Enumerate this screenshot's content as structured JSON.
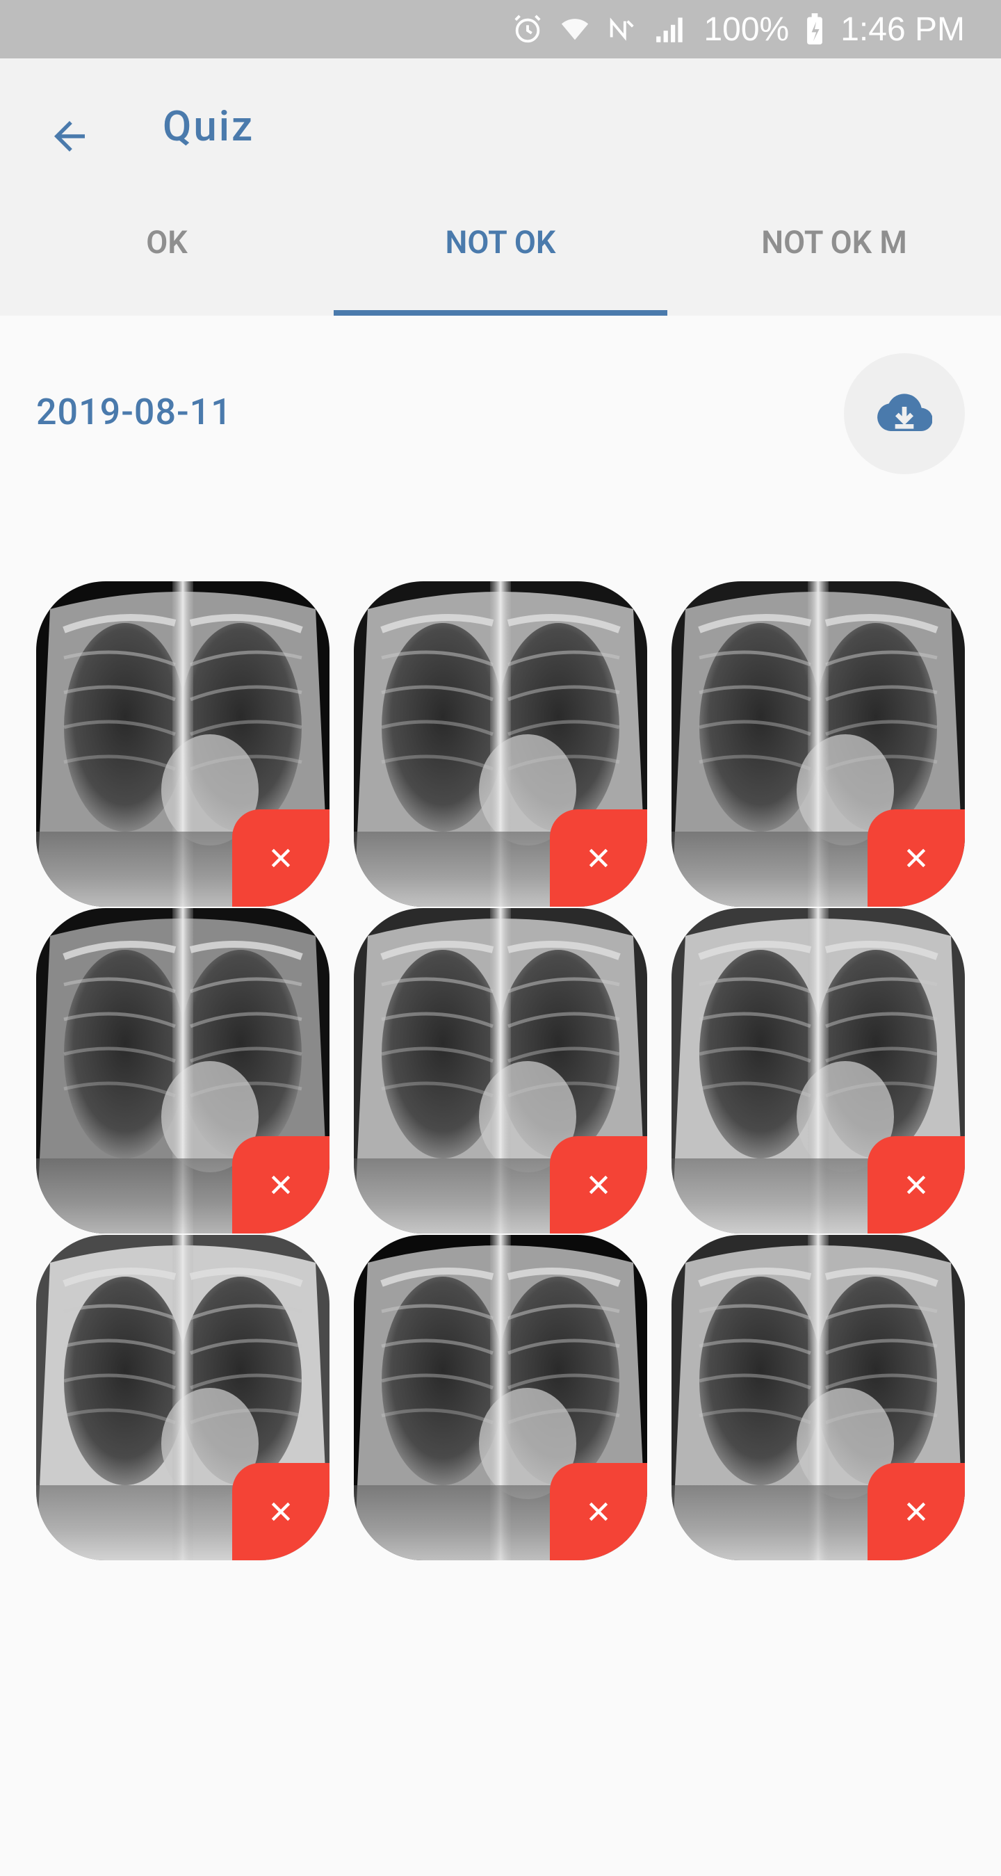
{
  "status_bar": {
    "battery": "100%",
    "time": "1:46 PM"
  },
  "app_bar": {
    "title": "Quiz",
    "back_icon": "arrow-left-icon"
  },
  "tabs": [
    {
      "label": "OK",
      "active": false
    },
    {
      "label": "NOT OK",
      "active": true
    },
    {
      "label": "NOT OK M",
      "active": false
    }
  ],
  "content": {
    "date": "2019-08-11",
    "download_icon": "cloud-download-icon"
  },
  "images": [
    {
      "kind": "chest-xray",
      "remove_icon": "close-icon"
    },
    {
      "kind": "chest-xray",
      "remove_icon": "close-icon"
    },
    {
      "kind": "chest-xray",
      "remove_icon": "close-icon"
    },
    {
      "kind": "chest-xray",
      "remove_icon": "close-icon"
    },
    {
      "kind": "chest-xray",
      "remove_icon": "close-icon"
    },
    {
      "kind": "chest-xray",
      "remove_icon": "close-icon"
    },
    {
      "kind": "chest-xray",
      "remove_icon": "close-icon"
    },
    {
      "kind": "chest-xray",
      "remove_icon": "close-icon"
    },
    {
      "kind": "chest-xray",
      "remove_icon": "close-icon"
    }
  ],
  "colors": {
    "accent": "#4a7aac",
    "remove": "#f44336",
    "status_bar": "#bdbdbd"
  }
}
